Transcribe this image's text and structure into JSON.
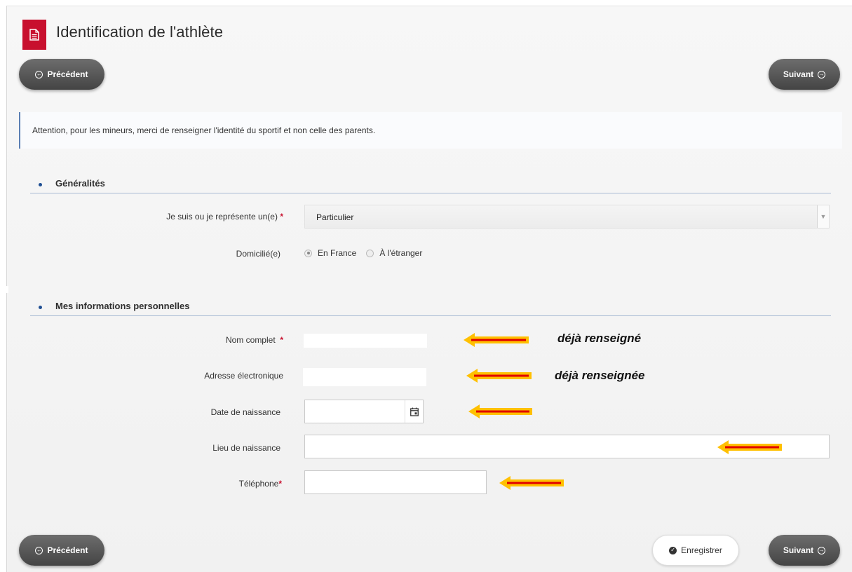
{
  "page": {
    "title": "Identification de l'athlète"
  },
  "nav": {
    "prev_label": "Précédent",
    "next_label": "Suivant",
    "save_label": "Enregistrer"
  },
  "notice": "Attention, pour les mineurs, merci de renseigner l'identité du sportif et non celle des parents.",
  "sections": {
    "general": {
      "title": "Généralités",
      "represent_label": "Je suis ou je représente un(e)",
      "represent_value": "Particulier",
      "domicile_label": "Domicilié(e)",
      "domicile_options": [
        "En France",
        "À l'étranger"
      ],
      "domicile_selected": "En France"
    },
    "personal": {
      "title": "Mes informations personnelles",
      "name_label": "Nom complet",
      "email_label": "Adresse électronique",
      "birthdate_label": "Date de naissance",
      "birthplace_label": "Lieu de naissance",
      "phone_label": "Téléphone"
    }
  },
  "annotations": {
    "name_note": "déjà renseigné",
    "email_note": "déjà renseignée"
  },
  "colors": {
    "brand_red": "#c8102e",
    "arrow_fill": "#ffc000",
    "arrow_line": "#e00000",
    "section_rule": "#a7bad3"
  },
  "icons": {
    "title_icon": "document-icon",
    "prev_icon": "arrow-left-circle-icon",
    "next_icon": "arrow-right-circle-icon",
    "save_icon": "check-circle-icon",
    "date_icon": "calendar-icon"
  }
}
